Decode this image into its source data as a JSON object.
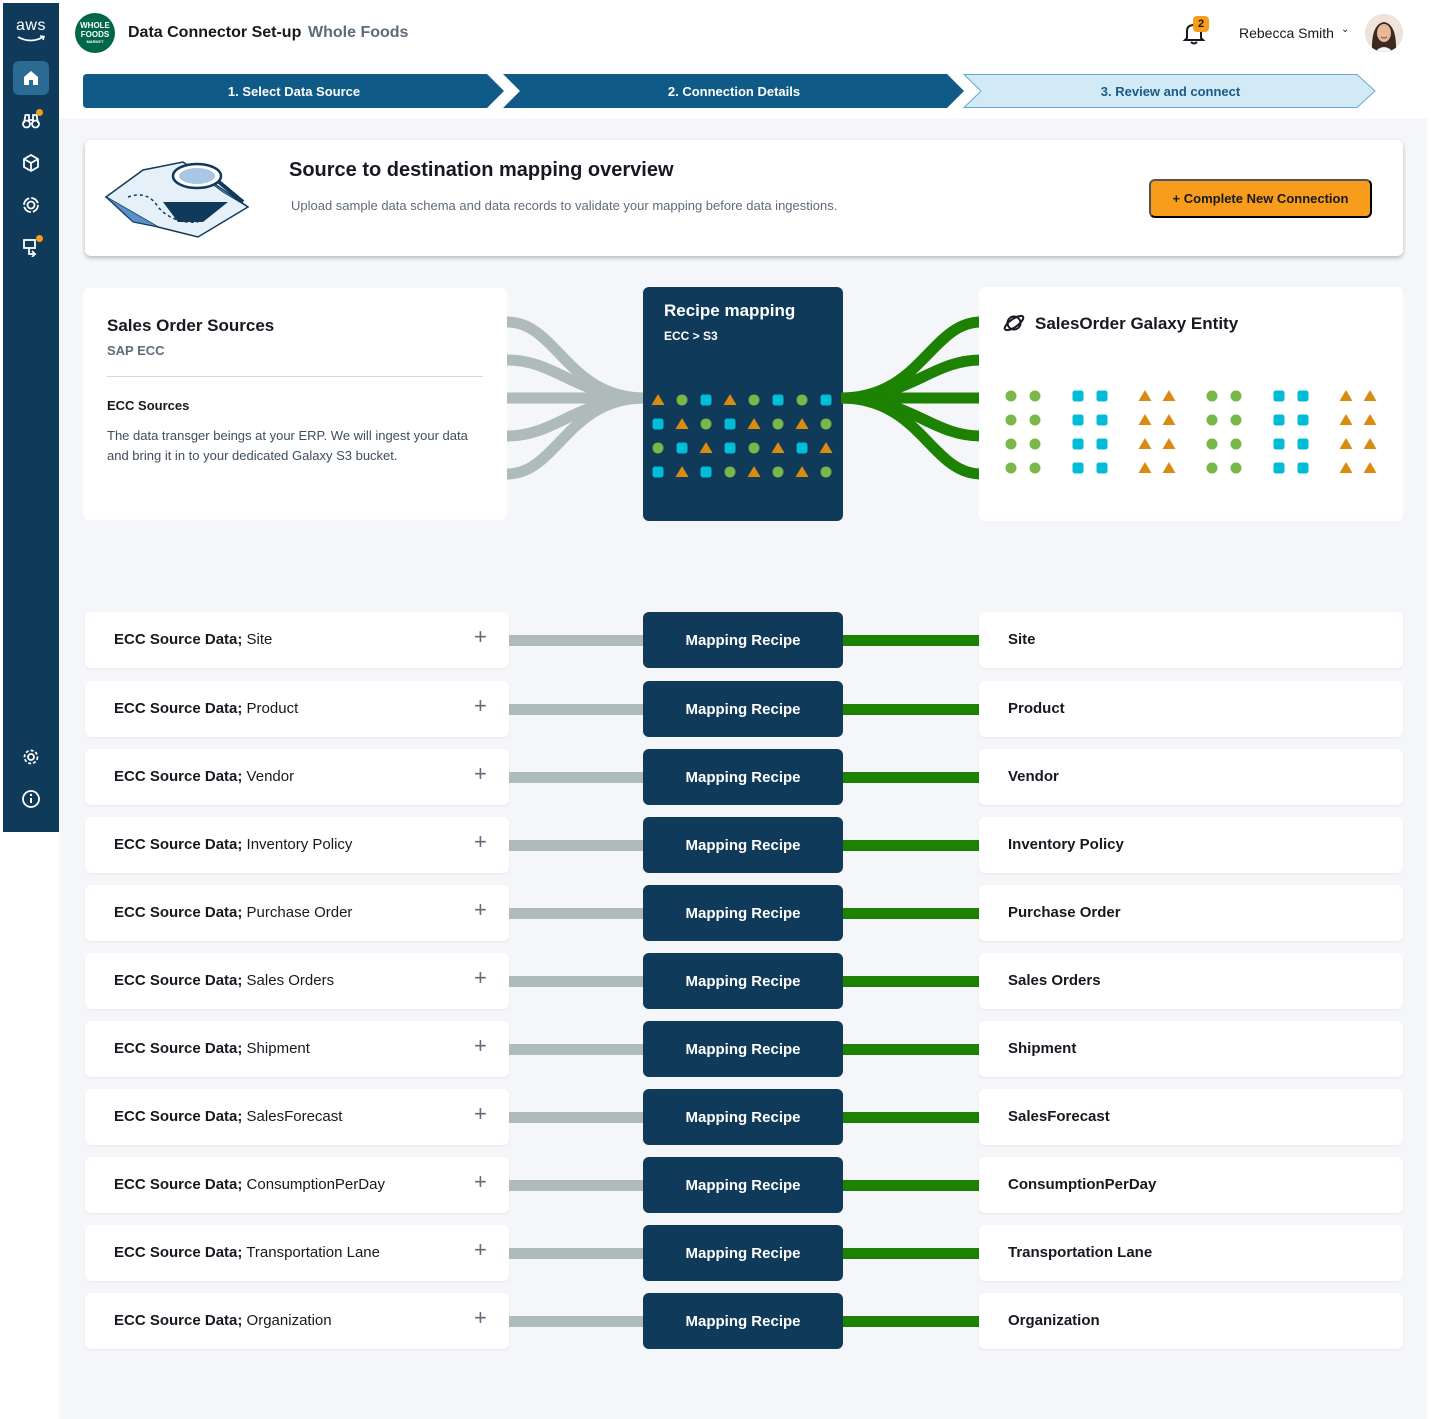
{
  "app": {
    "logo_text": "aws",
    "brand_logo_lines": [
      "WHOLE",
      "FOODS",
      "MARKET"
    ],
    "title": "Data Connector Set-up",
    "subtitle": "Whole Foods"
  },
  "header": {
    "notification_count": "2",
    "user_name": "Rebecca Smith"
  },
  "sidebar": {
    "items": [
      {
        "name": "home-icon",
        "active": true,
        "badge": false
      },
      {
        "name": "binoculars-icon",
        "active": false,
        "badge": true
      },
      {
        "name": "package-icon",
        "active": false,
        "badge": false
      },
      {
        "name": "target-icon",
        "active": false,
        "badge": false
      },
      {
        "name": "connector-icon",
        "active": false,
        "badge": true
      }
    ],
    "bottom_items": [
      {
        "name": "gear-icon"
      },
      {
        "name": "info-icon"
      }
    ]
  },
  "stepper": {
    "steps": [
      {
        "label": "1. Select Data Source",
        "state": "complete"
      },
      {
        "label": "2. Connection Details",
        "state": "complete"
      },
      {
        "label": "3. Review and connect",
        "state": "current"
      }
    ]
  },
  "overview": {
    "title": "Source to destination mapping overview",
    "description": "Upload sample data schema and data records to validate your mapping before data ingestions.",
    "button_label": "+ Complete New Connection"
  },
  "source_card": {
    "title": "Sales Order Sources",
    "subtitle": "SAP ECC",
    "section_title": "ECC Sources",
    "description": "The data transger beings at your ERP. We will ingest your data and bring it in to your dedicated Galaxy S3 bucket."
  },
  "recipe_card": {
    "title": "Recipe mapping",
    "path": "ECC  >  S3"
  },
  "destination_card": {
    "title": "SalesOrder Galaxy Entity"
  },
  "colors": {
    "navy": "#0f3a5a",
    "accent_orange": "#f89c1c",
    "green_connector": "#1d8102",
    "grey_connector": "#afbbbb",
    "dot_green": "#7ab648",
    "dot_cyan": "#00bcd9",
    "tri_orange": "#d98b0f"
  },
  "mappings": {
    "source_prefix": "ECC Source Data;",
    "recipe_label": "Mapping Recipe",
    "rows": [
      {
        "source": "Site",
        "destination": "Site"
      },
      {
        "source": "Product",
        "destination": "Product"
      },
      {
        "source": "Vendor",
        "destination": "Vendor"
      },
      {
        "source": "Inventory Policy",
        "destination": "Inventory Policy"
      },
      {
        "source": "Purchase Order",
        "destination": "Purchase Order"
      },
      {
        "source": "Sales Orders",
        "destination": "Sales Orders"
      },
      {
        "source": "Shipment",
        "destination": "Shipment"
      },
      {
        "source": "SalesForecast",
        "destination": "SalesForecast"
      },
      {
        "source": "ConsumptionPerDay",
        "destination": "ConsumptionPerDay"
      },
      {
        "source": "Transportation Lane",
        "destination": "Transportation Lane"
      },
      {
        "source": "Organization",
        "destination": "Organization"
      }
    ]
  }
}
